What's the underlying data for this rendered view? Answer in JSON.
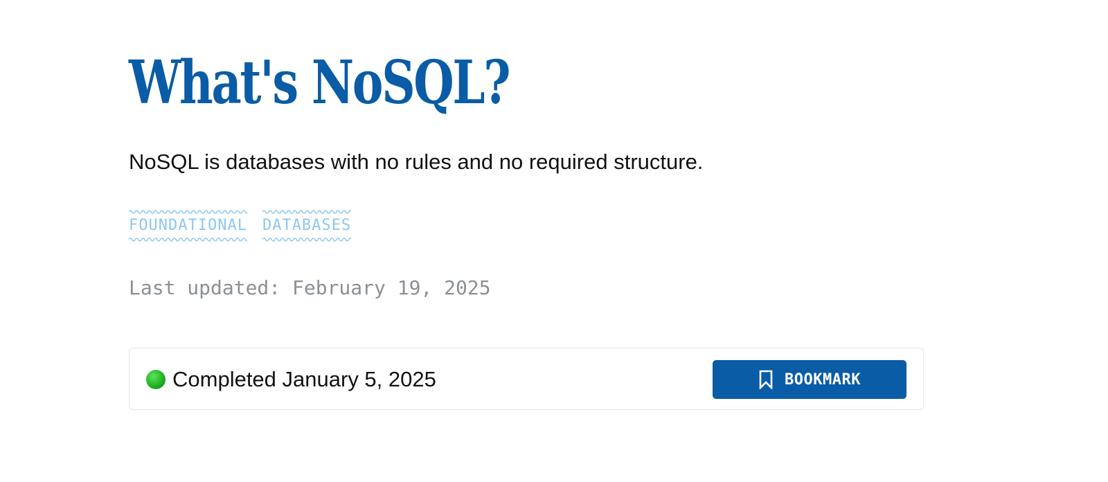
{
  "article": {
    "title": "What's NoSQL?",
    "subtitle": "NoSQL is databases with no rules and no required structure.",
    "tags": [
      "FOUNDATIONAL",
      "DATABASES"
    ],
    "last_updated": "Last updated: February 19, 2025"
  },
  "progress": {
    "status_icon": "green-circle-icon",
    "status_text": "Completed January 5, 2025",
    "bookmark_label": "BOOKMARK",
    "bookmark_icon": "bookmark-icon"
  },
  "colors": {
    "title": "#0a5ca6",
    "tag": "#8cc8f0",
    "button": "#0a5ca6",
    "muted": "#8a9095",
    "status_green": "#22b322"
  }
}
